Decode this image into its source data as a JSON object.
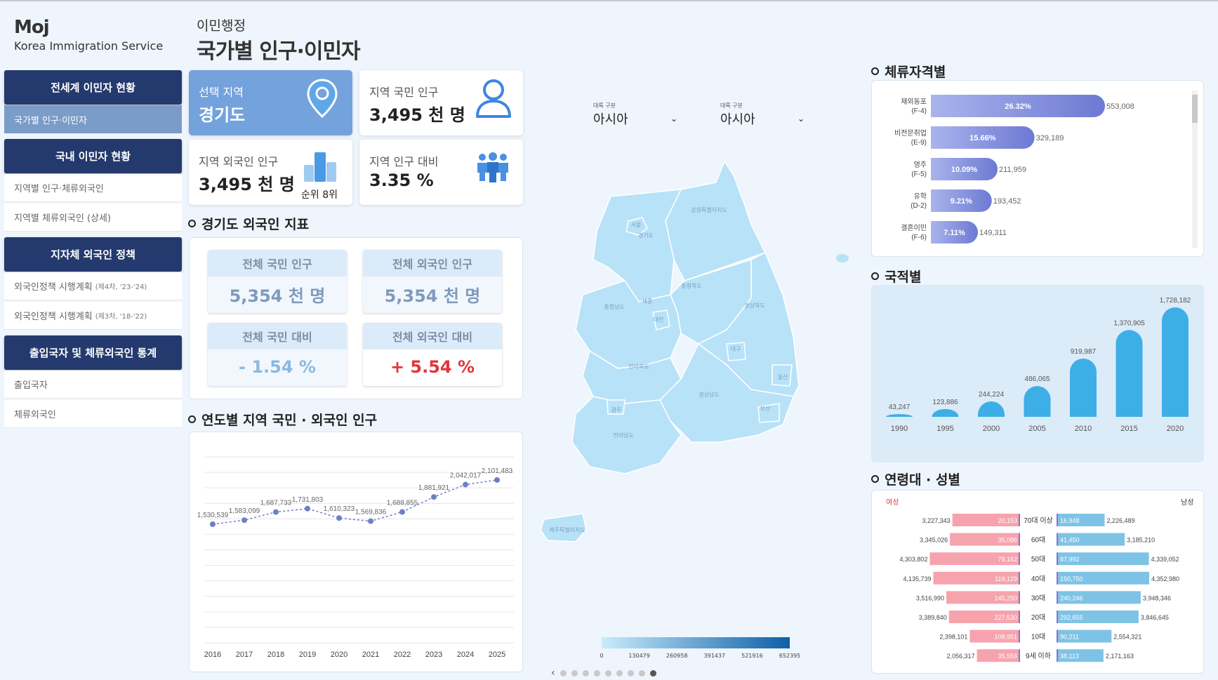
{
  "brand": {
    "name": "Moj",
    "subtitle": "Korea Immigration Service"
  },
  "page": {
    "subtitle": "이민행정",
    "title": "국가별 인구·이민자"
  },
  "sidebar": {
    "sections": [
      {
        "head": "전세계 이민자 현황",
        "items": [
          {
            "label": "국가별 인구·이민자",
            "note": "",
            "active": true
          }
        ]
      },
      {
        "head": "국내 이민자 현황",
        "items": [
          {
            "label": "지역별 인구·체류외국인",
            "note": ""
          },
          {
            "label": "지역별 체류외국인 (상세)",
            "note": ""
          }
        ]
      },
      {
        "head": "지자체 외국인 정책",
        "items": [
          {
            "label": "외국인정책 시행계획",
            "note": "(제4차, '23-'24)"
          },
          {
            "label": "외국인정책 시행계획",
            "note": "(제3차, '18-'22)"
          }
        ]
      },
      {
        "head": "출입국자 및 체류외국인 통계",
        "items": [
          {
            "label": "출입국자",
            "note": ""
          },
          {
            "label": "체류외국인",
            "note": ""
          }
        ]
      }
    ]
  },
  "cards": {
    "region": {
      "label": "선택 지역",
      "value": "경기도",
      "icon": "location-pin-icon"
    },
    "national_pop": {
      "label": "지역 국민 인구",
      "value": "3,495 천 명",
      "icon": "person-icon"
    },
    "foreign_pop": {
      "label": "지역 외국인 인구",
      "value": "3,495 천 명",
      "rank": "순위 8위",
      "icon": "bar-chart-icon"
    },
    "ratio": {
      "label": "지역 인구 대비",
      "value": "3.35 %",
      "icon": "people-group-icon"
    }
  },
  "indicators": {
    "title": "경기도 외국인 지표",
    "items": [
      {
        "label": "전체 국민 인구",
        "value": "5,354 천 명"
      },
      {
        "label": "전체 외국인 인구",
        "value": "5,354 천 명"
      },
      {
        "label": "전체 국민 대비",
        "value": "- 1.54 %"
      },
      {
        "label": "전체 외국인 대비",
        "value": "+ 5.54 %"
      }
    ]
  },
  "dropdowns": [
    {
      "caption": "대륙 구분",
      "value": "아시아"
    },
    {
      "caption": "대륙 구분",
      "value": "아시아"
    }
  ],
  "map": {
    "regions": [
      "서울",
      "경기도",
      "강원특별자치도",
      "충청북도",
      "충청남도",
      "세종",
      "대전",
      "경상북도",
      "대구",
      "전라북도",
      "울산",
      "경상남도",
      "부산",
      "광주",
      "전라남도",
      "제주특별자치도"
    ],
    "legend_ticks": [
      "0",
      "130479",
      "260958",
      "391437",
      "521916",
      "652395"
    ],
    "colors": {
      "low": "#b8e2f8",
      "high": "#0d5fa8"
    },
    "pager": {
      "pages": 9,
      "current": 9
    }
  },
  "colors": {
    "navy": "#243a6e",
    "accent": "#74a2dc",
    "female": "#f7a3ad",
    "male": "#7ec3e6",
    "bar_purple": "#8c96dc",
    "column_blue": "#3eaee6"
  },
  "chart_data": [
    {
      "type": "line",
      "title": "연도별 지역 국민 · 외국인 인구",
      "x": [
        "2016",
        "2017",
        "2018",
        "2019",
        "2020",
        "2021",
        "2022",
        "2023",
        "2024",
        "2025"
      ],
      "series": [
        {
          "values": [
            1530539,
            1583099,
            1687733,
            1731803,
            1610323,
            1569836,
            1688855,
            1881921,
            2042017,
            2101483
          ]
        }
      ],
      "data_labels": [
        "1,530,539",
        "1,583,099",
        "1,687,733",
        "1,731,803",
        "1,610,323",
        "1,569,836",
        "1,688,855",
        "1,881,921",
        "2,042,017",
        "2,101,483"
      ],
      "ylim": [
        0,
        2400000
      ],
      "grid": true
    },
    {
      "type": "bar",
      "title": "체류자격별",
      "orientation": "horizontal",
      "categories": [
        [
          "재외동포",
          "(F-4)"
        ],
        [
          "비전문취업",
          "(E-9)"
        ],
        [
          "영주",
          "(F-5)"
        ],
        [
          "유학",
          "(D-2)"
        ],
        [
          "결혼이민",
          "(F-6)"
        ]
      ],
      "values": [
        553008,
        329189,
        211959,
        193452,
        149311
      ],
      "value_labels": [
        "553,008",
        "329,189",
        "211,959",
        "193,452",
        "149,311"
      ],
      "percent_labels": [
        "26.32%",
        "15.66%",
        "10.09%",
        "9.21%",
        "7.11%"
      ]
    },
    {
      "type": "bar",
      "title": "국적별",
      "categories": [
        "1990",
        "1995",
        "2000",
        "2005",
        "2010",
        "2015",
        "2020"
      ],
      "values": [
        43247,
        123886,
        244224,
        486065,
        919987,
        1370905,
        1728182
      ],
      "value_labels": [
        "43,247",
        "123,886",
        "244,224",
        "486,065",
        "919,987",
        "1,370,905",
        "1,728,182"
      ],
      "ylim": [
        0,
        1728182
      ]
    },
    {
      "type": "bar",
      "title": "연령대 · 성별",
      "female_label": "여성",
      "male_label": "남성",
      "categories": [
        "70대 이상",
        "60대",
        "50대",
        "40대",
        "30대",
        "20대",
        "10대",
        "9세 이하"
      ],
      "female_totals": [
        "3,227,343",
        "3,345,026",
        "4,303,802",
        "4,135,739",
        "3,516,990",
        "3,389,840",
        "2,398,101",
        "2,056,317"
      ],
      "female_total_values": [
        3227343,
        3345026,
        4303802,
        4135739,
        3516990,
        3389840,
        2398101,
        2056317
      ],
      "female_inner": [
        "20,153",
        "35,086",
        "78,162",
        "119,129",
        "145,250",
        "227,530",
        "108,951",
        "35,556"
      ],
      "male_inner": [
        "16,948",
        "41,450",
        "87,992",
        "150,750",
        "240,246",
        "292,655",
        "90,211",
        "38,113"
      ],
      "male_totals": [
        "2,226,489",
        "3,185,210",
        "4,339,052",
        "4,352,980",
        "3,948,346",
        "3,846,645",
        "2,554,321",
        "2,171,163"
      ],
      "male_total_values": [
        2226489,
        3185210,
        4339052,
        4352980,
        3948346,
        3846645,
        2554321,
        2171163
      ],
      "xlim": [
        0,
        4352980
      ]
    }
  ]
}
